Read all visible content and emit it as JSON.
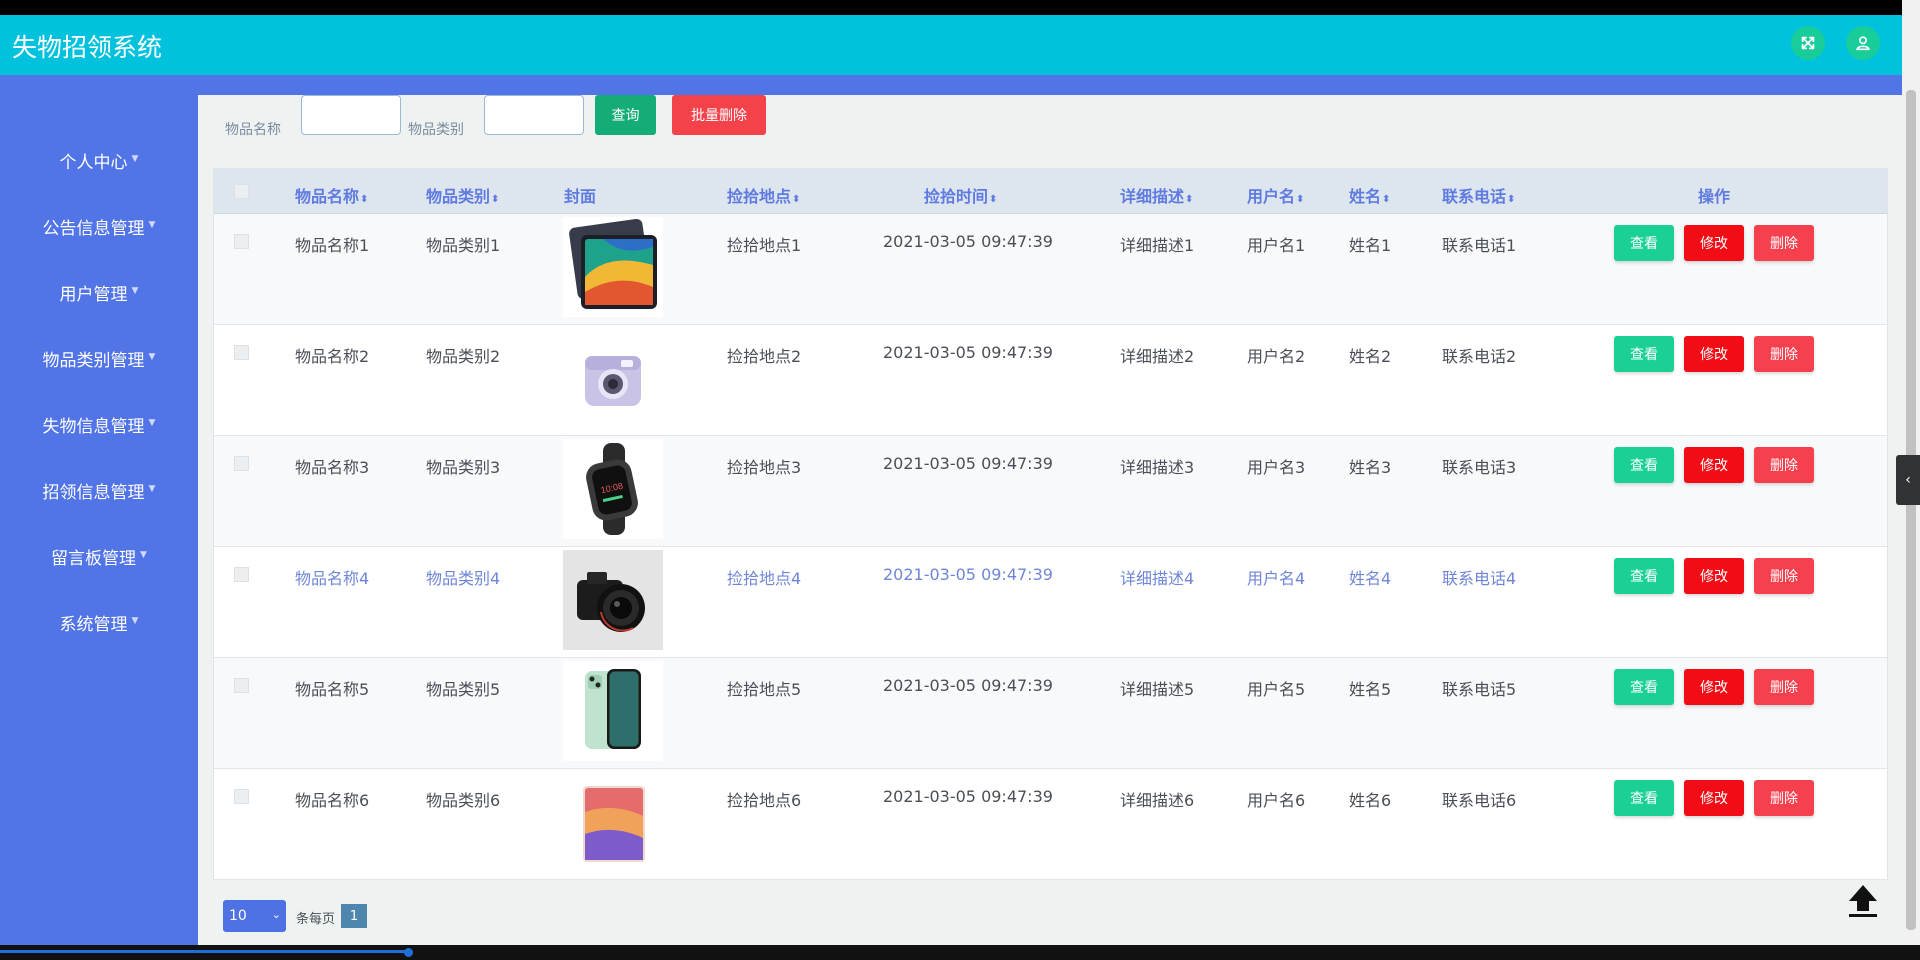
{
  "app": {
    "title": "失物招领系统"
  },
  "topbar": {
    "icons": [
      "fullscreen-icon",
      "user-icon"
    ]
  },
  "sidebar": {
    "items": [
      {
        "label": "个人中心"
      },
      {
        "label": "公告信息管理"
      },
      {
        "label": "用户管理"
      },
      {
        "label": "物品类别管理"
      },
      {
        "label": "失物信息管理"
      },
      {
        "label": "招领信息管理"
      },
      {
        "label": "留言板管理"
      },
      {
        "label": "系统管理"
      }
    ]
  },
  "search": {
    "name_label": "物品名称",
    "name_value": "",
    "category_label": "物品类别",
    "category_value": "",
    "search_button": "查询",
    "batch_delete_button": "批量删除"
  },
  "table": {
    "columns": [
      "物品名称",
      "物品类别",
      "封面",
      "捡拾地点",
      "捡拾时间",
      "详细描述",
      "用户名",
      "姓名",
      "联系电话",
      "操作"
    ],
    "sortable": [
      true,
      true,
      false,
      true,
      true,
      true,
      true,
      true,
      true,
      false
    ],
    "rows": [
      {
        "name": "物品名称1",
        "category": "物品类别1",
        "cover": "tablet",
        "place": "捡拾地点1",
        "time": "2021-03-05 09:47:39",
        "desc": "详细描述1",
        "username": "用户名1",
        "realname": "姓名1",
        "phone": "联系电话1"
      },
      {
        "name": "物品名称2",
        "category": "物品类别2",
        "cover": "instant-camera",
        "place": "捡拾地点2",
        "time": "2021-03-05 09:47:39",
        "desc": "详细描述2",
        "username": "用户名2",
        "realname": "姓名2",
        "phone": "联系电话2"
      },
      {
        "name": "物品名称3",
        "category": "物品类别3",
        "cover": "smart-band",
        "place": "捡拾地点3",
        "time": "2021-03-05 09:47:39",
        "desc": "详细描述3",
        "username": "用户名3",
        "realname": "姓名3",
        "phone": "联系电话3"
      },
      {
        "name": "物品名称4",
        "category": "物品类别4",
        "cover": "dslr-camera",
        "place": "捡拾地点4",
        "time": "2021-03-05 09:47:39",
        "desc": "详细描述4",
        "username": "用户名4",
        "realname": "姓名4",
        "phone": "联系电话4"
      },
      {
        "name": "物品名称5",
        "category": "物品类别5",
        "cover": "smartphone",
        "place": "捡拾地点5",
        "time": "2021-03-05 09:47:39",
        "desc": "详细描述5",
        "username": "用户名5",
        "realname": "姓名5",
        "phone": "联系电话5"
      },
      {
        "name": "物品名称6",
        "category": "物品类别6",
        "cover": "ipad",
        "place": "捡拾地点6",
        "time": "2021-03-05 09:47:39",
        "desc": "详细描述6",
        "username": "用户名6",
        "realname": "姓名6",
        "phone": "联系电话6"
      }
    ],
    "actions": {
      "view": "查看",
      "edit": "修改",
      "delete": "删除"
    }
  },
  "pagination": {
    "page_size": "10",
    "per_page_label": "条每页",
    "current_page": "1"
  },
  "colors": {
    "topbar": "#00c2dd",
    "sidebar": "#5174e7",
    "view": "#1ad095",
    "edit": "#f20d16",
    "delete": "#f6404e",
    "header_text": "#5f7be0"
  }
}
